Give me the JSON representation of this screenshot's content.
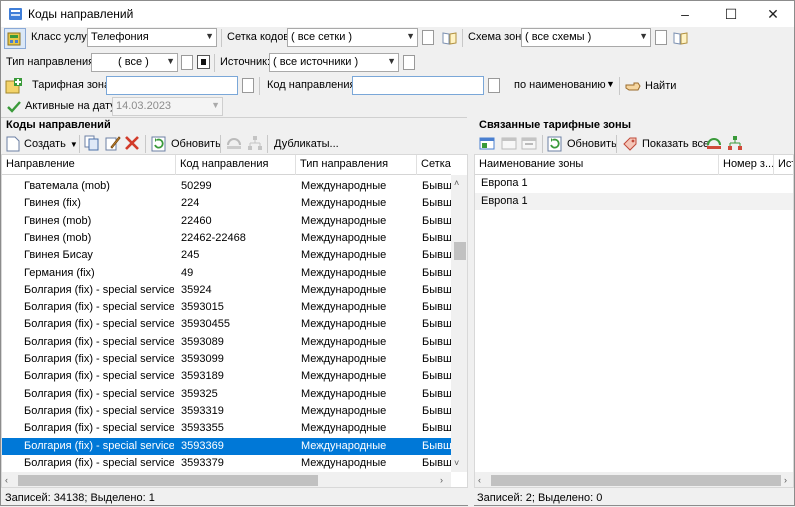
{
  "window": {
    "title": "Коды направлений",
    "minimize": "–",
    "maximize": "☐",
    "close": "✕"
  },
  "filters": {
    "service_class_label": "Класс услуг:",
    "service_class_value": "Телефония",
    "code_grid_label": "Сетка кодов:",
    "code_grid_value": "( все сетки )",
    "zone_scheme_label": "Схема зон:",
    "zone_scheme_value": "( все схемы )",
    "direction_type_label": "Тип направления:",
    "direction_type_value": "( все )",
    "source_label": "Источник:",
    "source_value": "( все источники )",
    "tariff_zone_label": "Тарифная зона:",
    "tariff_zone_value": "",
    "direction_code_label": "Код направления:",
    "direction_code_value": "",
    "search_mode_value": "по наименованию",
    "find_label": "Найти",
    "active_on_date_label": "Активные на дату:",
    "active_on_date_value": "14.03.2023"
  },
  "left_panel": {
    "title": "Коды направлений",
    "toolbar": {
      "create_label": "Создать",
      "refresh_label": "Обновить",
      "duplicates_label": "Дубликаты..."
    },
    "columns": [
      "Направление",
      "Код направления",
      "Тип направления",
      "Сетка кодо"
    ],
    "rows": [
      {
        "name": "Гватемала (mob)",
        "code": "50299",
        "type": "Международные",
        "grid": "Бывша"
      },
      {
        "name": "Гвинея (fix)",
        "code": "224",
        "type": "Международные",
        "grid": "Бывша"
      },
      {
        "name": "Гвинея (mob)",
        "code": "22460",
        "type": "Международные",
        "grid": "Бывша"
      },
      {
        "name": "Гвинея (mob)",
        "code": "22462-22468",
        "type": "Международные",
        "grid": "Бывша"
      },
      {
        "name": "Гвинея Бисау",
        "code": "245",
        "type": "Международные",
        "grid": "Бывша"
      },
      {
        "name": "Германия (fix)",
        "code": "49",
        "type": "Международные",
        "grid": "Бывша"
      },
      {
        "name": "Болгария (fix) - special services",
        "code": "35924",
        "type": "Международные",
        "grid": "Бывша"
      },
      {
        "name": "Болгария (fix) - special services",
        "code": "3593015",
        "type": "Международные",
        "grid": "Бывша"
      },
      {
        "name": "Болгария (fix) - special services",
        "code": "35930455",
        "type": "Международные",
        "grid": "Бывша"
      },
      {
        "name": "Болгария (fix) - special services",
        "code": "3593089",
        "type": "Международные",
        "grid": "Бывша"
      },
      {
        "name": "Болгария (fix) - special services",
        "code": "3593099",
        "type": "Международные",
        "grid": "Бывша"
      },
      {
        "name": "Болгария (fix) - special services",
        "code": "3593189",
        "type": "Международные",
        "grid": "Бывша"
      },
      {
        "name": "Болгария (fix) - special services",
        "code": "359325",
        "type": "Международные",
        "grid": "Бывша"
      },
      {
        "name": "Болгария (fix) - special services",
        "code": "3593319",
        "type": "Международные",
        "grid": "Бывша"
      },
      {
        "name": "Болгария (fix) - special services",
        "code": "3593355",
        "type": "Международные",
        "grid": "Бывша"
      },
      {
        "name": "Болгария (fix) - special services",
        "code": "3593369",
        "type": "Международные",
        "grid": "Бывша",
        "selected": true
      },
      {
        "name": "Болгария (fix) - special services",
        "code": "3593379",
        "type": "Международные",
        "grid": "Бывша"
      }
    ],
    "status": "Записей: 34138; Выделено: 1"
  },
  "right_panel": {
    "title": "Связанные тарифные зоны",
    "toolbar": {
      "refresh_label": "Обновить",
      "show_all_label": "Показать все"
    },
    "columns": [
      "Наименование зоны",
      "Номер з...",
      "Исто"
    ],
    "rows": [
      {
        "name": "Европа 1"
      },
      {
        "name": "Европа 1"
      }
    ],
    "status": "Записей: 2; Выделено: 0"
  },
  "colors": {
    "selection": "#0078d7",
    "accent_green": "#3a9a3a",
    "delete_red": "#d23b2a"
  }
}
